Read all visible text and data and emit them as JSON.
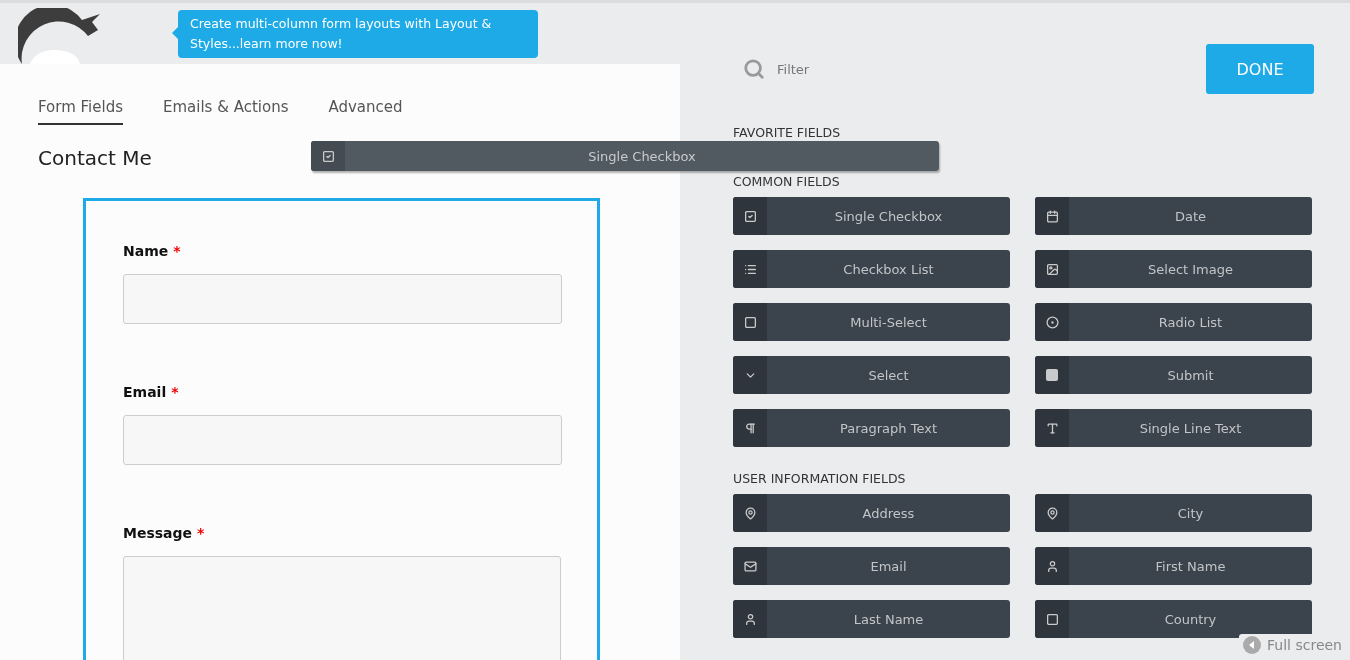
{
  "banner": {
    "text": "Create multi-column form layouts with Layout & Styles...learn more now!"
  },
  "tabs": [
    {
      "label": "Form Fields",
      "selected": true
    },
    {
      "label": "Emails & Actions",
      "selected": false
    },
    {
      "label": "Advanced",
      "selected": false
    }
  ],
  "form": {
    "title": "Contact Me",
    "fields": [
      {
        "label": "Name",
        "required_mark": "*",
        "kind": "input"
      },
      {
        "label": "Email",
        "required_mark": "*",
        "kind": "input"
      },
      {
        "label": "Message",
        "required_mark": "*",
        "kind": "textarea"
      }
    ]
  },
  "dragged_field": {
    "label": "Single Checkbox",
    "kind": "checkbox"
  },
  "filter": {
    "placeholder": "Filter"
  },
  "done_button": "DONE",
  "sections": [
    {
      "title": "FAVORITE FIELDS"
    },
    {
      "title": "COMMON FIELDS",
      "fields": [
        {
          "label": "Single Checkbox",
          "kind": "checkbox"
        },
        {
          "label": "Date",
          "kind": "calendar"
        },
        {
          "label": "Checkbox List",
          "kind": "list"
        },
        {
          "label": "Select Image",
          "kind": "image"
        },
        {
          "label": "Multi-Select",
          "kind": "square"
        },
        {
          "label": "Radio List",
          "kind": "radio"
        },
        {
          "label": "Select",
          "kind": "chevron"
        },
        {
          "label": "Submit",
          "kind": "solid-square"
        },
        {
          "label": "Paragraph Text",
          "kind": "pilcrow"
        },
        {
          "label": "Single Line Text",
          "kind": "text"
        }
      ]
    },
    {
      "title": "USER INFORMATION FIELDS",
      "fields": [
        {
          "label": "Address",
          "kind": "pin"
        },
        {
          "label": "City",
          "kind": "pin"
        },
        {
          "label": "Email",
          "kind": "mail"
        },
        {
          "label": "First Name",
          "kind": "user"
        },
        {
          "label": "Last Name",
          "kind": "user"
        },
        {
          "label": "Country",
          "kind": "square"
        }
      ]
    }
  ],
  "fullscreen_link": "Full screen"
}
